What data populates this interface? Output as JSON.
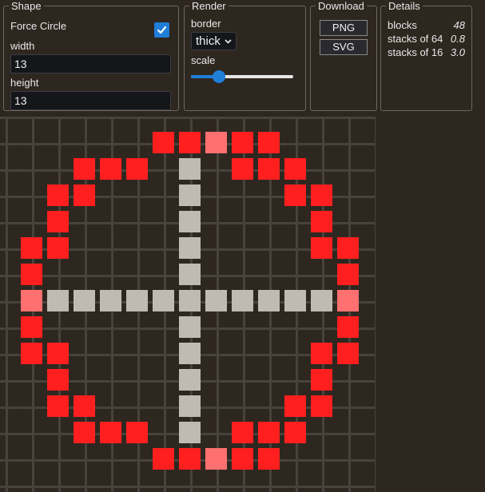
{
  "shape": {
    "legend": "Shape",
    "force_circle_label": "Force Circle",
    "force_circle_checked": true,
    "width_label": "width",
    "width_value": "13",
    "height_label": "height",
    "height_value": "13"
  },
  "render": {
    "legend": "Render",
    "border_label": "border",
    "border_value": "thick",
    "scale_label": "scale",
    "scale_fraction": 0.27
  },
  "download": {
    "legend": "Download",
    "png_label": "PNG",
    "svg_label": "SVG"
  },
  "details": {
    "legend": "Details",
    "rows": [
      {
        "label": "blocks",
        "value": "48"
      },
      {
        "label": "stacks of 64",
        "value": "0.8"
      },
      {
        "label": "stacks of 16",
        "value": "3.0"
      }
    ]
  },
  "grid": {
    "size": 13,
    "colors": {
      "block": "#ff1f1f",
      "block_axis": "#ff7070",
      "axis": "#c0bbb2",
      "background": "#2e2720",
      "gridline": "#48423c",
      "accent": "#1f7ed8"
    },
    "rows": [
      ".....RRARR...",
      "..RRR.M.RRR..",
      ".RR...M...RR.",
      ".R....M....R.",
      "RR....M....RR",
      "R.....M.....R",
      "AMMMMMMMMMMMA",
      "R.....M.....R",
      "RR....M....RR",
      ".R....M....R.",
      ".RR...M...RR.",
      "..RRR.M.RRR..",
      ".....RRARR..."
    ]
  }
}
